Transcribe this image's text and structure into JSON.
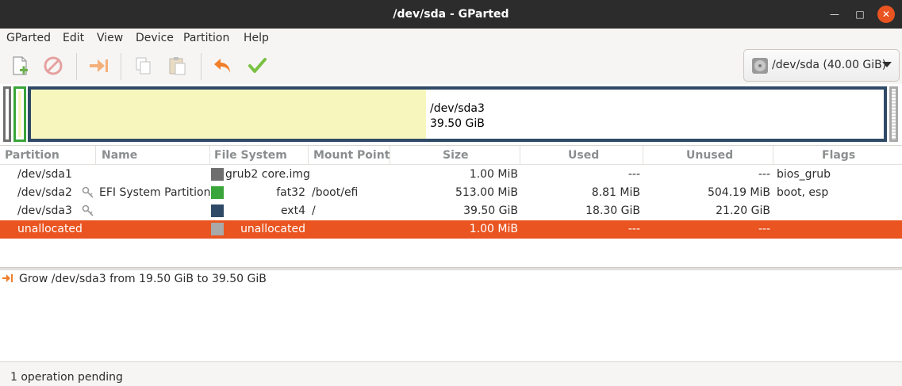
{
  "window": {
    "title": "/dev/sda - GParted",
    "minimize_glyph": "—",
    "maximize_glyph": "□",
    "close_glyph": "✕"
  },
  "menubar": {
    "items": [
      "GParted",
      "Edit",
      "View",
      "Device",
      "Partition",
      "Help"
    ]
  },
  "toolbar": {
    "icons": [
      "new-partition-icon",
      "delete-icon",
      "resize-move-icon",
      "copy-icon",
      "paste-icon",
      "undo-icon",
      "apply-icon"
    ],
    "device_label": "/dev/sda (40.00 GiB)"
  },
  "diskmap": {
    "selected_partition": "/dev/sda3",
    "selected_size": "39.50 GiB"
  },
  "table": {
    "headers": [
      "Partition",
      "Name",
      "File System",
      "Mount Point",
      "Size",
      "Used",
      "Unused",
      "Flags"
    ],
    "rows": [
      {
        "partition": "/dev/sda1",
        "name": "",
        "filesystem": "grub2 core.img",
        "mount": "",
        "size": "1.00 MiB",
        "used": "---",
        "unused": "---",
        "flags": "bios_grub",
        "color": "#6f6f6f"
      },
      {
        "partition": "/dev/sda2",
        "name": "EFI System Partition",
        "filesystem": "fat32",
        "mount": "/boot/efi",
        "size": "513.00 MiB",
        "used": "8.81 MiB",
        "unused": "504.19 MiB",
        "flags": "boot, esp",
        "color": "#3aa53a"
      },
      {
        "partition": "/dev/sda3",
        "name": "",
        "filesystem": "ext4",
        "mount": "/",
        "size": "39.50 GiB",
        "used": "18.30 GiB",
        "unused": "21.20 GiB",
        "flags": "",
        "color": "#2f4a66"
      },
      {
        "partition": "unallocated",
        "name": "",
        "filesystem": "unallocated",
        "mount": "",
        "size": "1.00 MiB",
        "used": "---",
        "unused": "---",
        "flags": "",
        "color": "#a9a9a9"
      }
    ]
  },
  "operations": {
    "items": [
      "Grow /dev/sda3 from 19.50 GiB to 39.50 GiB"
    ]
  },
  "statusbar": {
    "text": "1 operation pending"
  },
  "colors": {
    "selection": "#e95420",
    "titlebar": "#2c2c2c",
    "used_space": "#f7f7bd"
  }
}
